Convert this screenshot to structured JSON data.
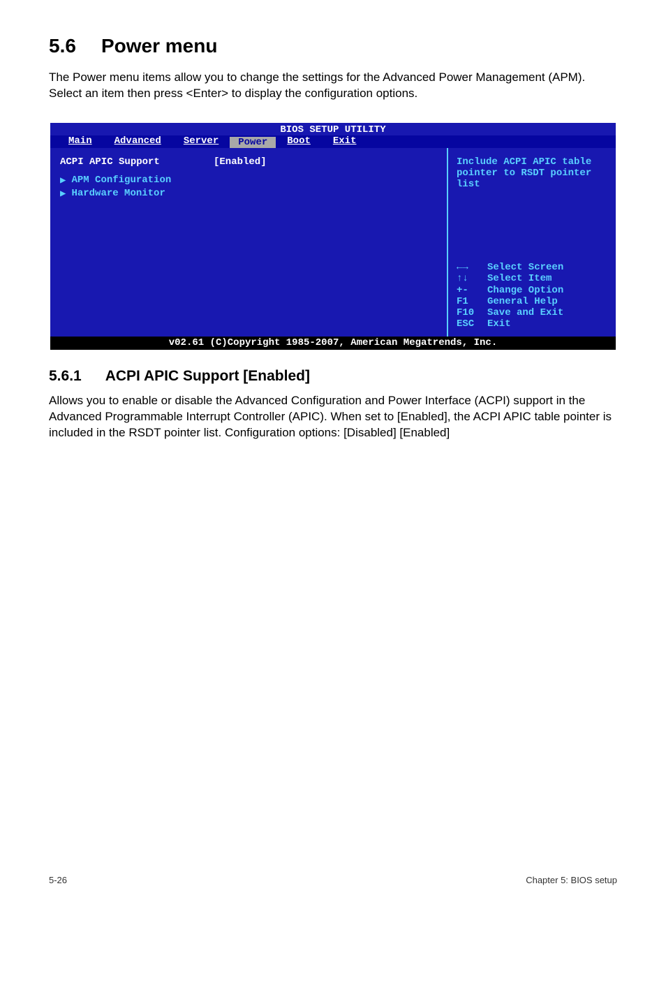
{
  "section": {
    "number": "5.6",
    "title": "Power menu",
    "intro": "The Power menu items allow you to change the settings for the Advanced Power Management (APM). Select an item then press <Enter> to display the configuration options."
  },
  "bios": {
    "title": "BIOS SETUP UTILITY",
    "tabs": [
      "Main",
      "Advanced",
      "Server",
      "Power",
      "Boot",
      "Exit"
    ],
    "active_tab": "Power",
    "acpi_label": "ACPI APIC Support",
    "acpi_value": "[Enabled]",
    "submenus": [
      "APM Configuration",
      "Hardware Monitor"
    ],
    "help": "Include ACPI APIC table pointer to RSDT pointer list",
    "keys": [
      {
        "k": "←→",
        "d": "Select Screen"
      },
      {
        "k": "↑↓",
        "d": "Select Item"
      },
      {
        "k": "+-",
        "d": "Change Option"
      },
      {
        "k": "F1",
        "d": "General Help"
      },
      {
        "k": "F10",
        "d": "Save and Exit"
      },
      {
        "k": "ESC",
        "d": "Exit"
      }
    ],
    "footer": "v02.61 (C)Copyright 1985-2007, American Megatrends, Inc."
  },
  "subsection": {
    "number": "5.6.1",
    "title": "ACPI APIC Support [Enabled]",
    "body": "Allows you to enable or disable the Advanced Configuration and Power Interface (ACPI) support in the Advanced Programmable Interrupt Controller (APIC). When set to [Enabled], the ACPI APIC table pointer is included in the RSDT pointer list. Configuration options: [Disabled] [Enabled]"
  },
  "footer": {
    "page": "5-26",
    "chapter": "Chapter 5: BIOS setup"
  }
}
